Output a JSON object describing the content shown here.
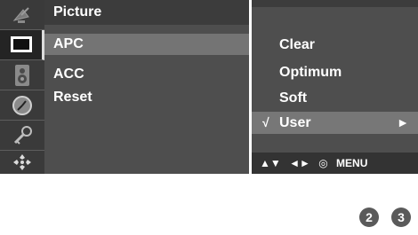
{
  "icons": [
    {
      "name": "satellite-antenna-icon"
    },
    {
      "name": "picture-screen-icon"
    },
    {
      "name": "speaker-icon"
    },
    {
      "name": "clock-icon"
    },
    {
      "name": "key-lock-icon"
    },
    {
      "name": "settings-option-icon"
    }
  ],
  "menu": {
    "title": "Picture",
    "items": [
      "APC",
      "ACC",
      "Reset"
    ],
    "selected": "APC"
  },
  "submenu": {
    "options": [
      "Clear",
      "Optimum",
      "Soft",
      "User"
    ],
    "selected": "User",
    "check_mark": "√",
    "arrow": "►"
  },
  "navbar": {
    "updown": "▲▼",
    "leftright": "◄►",
    "ok": "◎",
    "menu": "MENU"
  },
  "steps": [
    "2",
    "3"
  ]
}
